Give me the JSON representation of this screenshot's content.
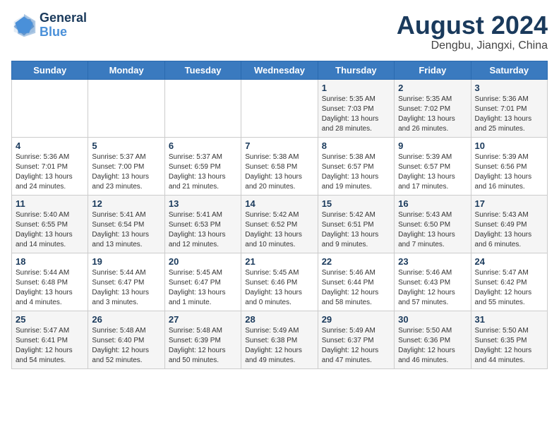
{
  "logo": {
    "line1": "General",
    "line2": "Blue"
  },
  "title": {
    "month_year": "August 2024",
    "location": "Dengbu, Jiangxi, China"
  },
  "days_of_week": [
    "Sunday",
    "Monday",
    "Tuesday",
    "Wednesday",
    "Thursday",
    "Friday",
    "Saturday"
  ],
  "weeks": [
    [
      {
        "day": "",
        "info": ""
      },
      {
        "day": "",
        "info": ""
      },
      {
        "day": "",
        "info": ""
      },
      {
        "day": "",
        "info": ""
      },
      {
        "day": "1",
        "info": "Sunrise: 5:35 AM\nSunset: 7:03 PM\nDaylight: 13 hours\nand 28 minutes."
      },
      {
        "day": "2",
        "info": "Sunrise: 5:35 AM\nSunset: 7:02 PM\nDaylight: 13 hours\nand 26 minutes."
      },
      {
        "day": "3",
        "info": "Sunrise: 5:36 AM\nSunset: 7:01 PM\nDaylight: 13 hours\nand 25 minutes."
      }
    ],
    [
      {
        "day": "4",
        "info": "Sunrise: 5:36 AM\nSunset: 7:01 PM\nDaylight: 13 hours\nand 24 minutes."
      },
      {
        "day": "5",
        "info": "Sunrise: 5:37 AM\nSunset: 7:00 PM\nDaylight: 13 hours\nand 23 minutes."
      },
      {
        "day": "6",
        "info": "Sunrise: 5:37 AM\nSunset: 6:59 PM\nDaylight: 13 hours\nand 21 minutes."
      },
      {
        "day": "7",
        "info": "Sunrise: 5:38 AM\nSunset: 6:58 PM\nDaylight: 13 hours\nand 20 minutes."
      },
      {
        "day": "8",
        "info": "Sunrise: 5:38 AM\nSunset: 6:57 PM\nDaylight: 13 hours\nand 19 minutes."
      },
      {
        "day": "9",
        "info": "Sunrise: 5:39 AM\nSunset: 6:57 PM\nDaylight: 13 hours\nand 17 minutes."
      },
      {
        "day": "10",
        "info": "Sunrise: 5:39 AM\nSunset: 6:56 PM\nDaylight: 13 hours\nand 16 minutes."
      }
    ],
    [
      {
        "day": "11",
        "info": "Sunrise: 5:40 AM\nSunset: 6:55 PM\nDaylight: 13 hours\nand 14 minutes."
      },
      {
        "day": "12",
        "info": "Sunrise: 5:41 AM\nSunset: 6:54 PM\nDaylight: 13 hours\nand 13 minutes."
      },
      {
        "day": "13",
        "info": "Sunrise: 5:41 AM\nSunset: 6:53 PM\nDaylight: 13 hours\nand 12 minutes."
      },
      {
        "day": "14",
        "info": "Sunrise: 5:42 AM\nSunset: 6:52 PM\nDaylight: 13 hours\nand 10 minutes."
      },
      {
        "day": "15",
        "info": "Sunrise: 5:42 AM\nSunset: 6:51 PM\nDaylight: 13 hours\nand 9 minutes."
      },
      {
        "day": "16",
        "info": "Sunrise: 5:43 AM\nSunset: 6:50 PM\nDaylight: 13 hours\nand 7 minutes."
      },
      {
        "day": "17",
        "info": "Sunrise: 5:43 AM\nSunset: 6:49 PM\nDaylight: 13 hours\nand 6 minutes."
      }
    ],
    [
      {
        "day": "18",
        "info": "Sunrise: 5:44 AM\nSunset: 6:48 PM\nDaylight: 13 hours\nand 4 minutes."
      },
      {
        "day": "19",
        "info": "Sunrise: 5:44 AM\nSunset: 6:47 PM\nDaylight: 13 hours\nand 3 minutes."
      },
      {
        "day": "20",
        "info": "Sunrise: 5:45 AM\nSunset: 6:47 PM\nDaylight: 13 hours\nand 1 minute."
      },
      {
        "day": "21",
        "info": "Sunrise: 5:45 AM\nSunset: 6:46 PM\nDaylight: 13 hours\nand 0 minutes."
      },
      {
        "day": "22",
        "info": "Sunrise: 5:46 AM\nSunset: 6:44 PM\nDaylight: 12 hours\nand 58 minutes."
      },
      {
        "day": "23",
        "info": "Sunrise: 5:46 AM\nSunset: 6:43 PM\nDaylight: 12 hours\nand 57 minutes."
      },
      {
        "day": "24",
        "info": "Sunrise: 5:47 AM\nSunset: 6:42 PM\nDaylight: 12 hours\nand 55 minutes."
      }
    ],
    [
      {
        "day": "25",
        "info": "Sunrise: 5:47 AM\nSunset: 6:41 PM\nDaylight: 12 hours\nand 54 minutes."
      },
      {
        "day": "26",
        "info": "Sunrise: 5:48 AM\nSunset: 6:40 PM\nDaylight: 12 hours\nand 52 minutes."
      },
      {
        "day": "27",
        "info": "Sunrise: 5:48 AM\nSunset: 6:39 PM\nDaylight: 12 hours\nand 50 minutes."
      },
      {
        "day": "28",
        "info": "Sunrise: 5:49 AM\nSunset: 6:38 PM\nDaylight: 12 hours\nand 49 minutes."
      },
      {
        "day": "29",
        "info": "Sunrise: 5:49 AM\nSunset: 6:37 PM\nDaylight: 12 hours\nand 47 minutes."
      },
      {
        "day": "30",
        "info": "Sunrise: 5:50 AM\nSunset: 6:36 PM\nDaylight: 12 hours\nand 46 minutes."
      },
      {
        "day": "31",
        "info": "Sunrise: 5:50 AM\nSunset: 6:35 PM\nDaylight: 12 hours\nand 44 minutes."
      }
    ]
  ]
}
